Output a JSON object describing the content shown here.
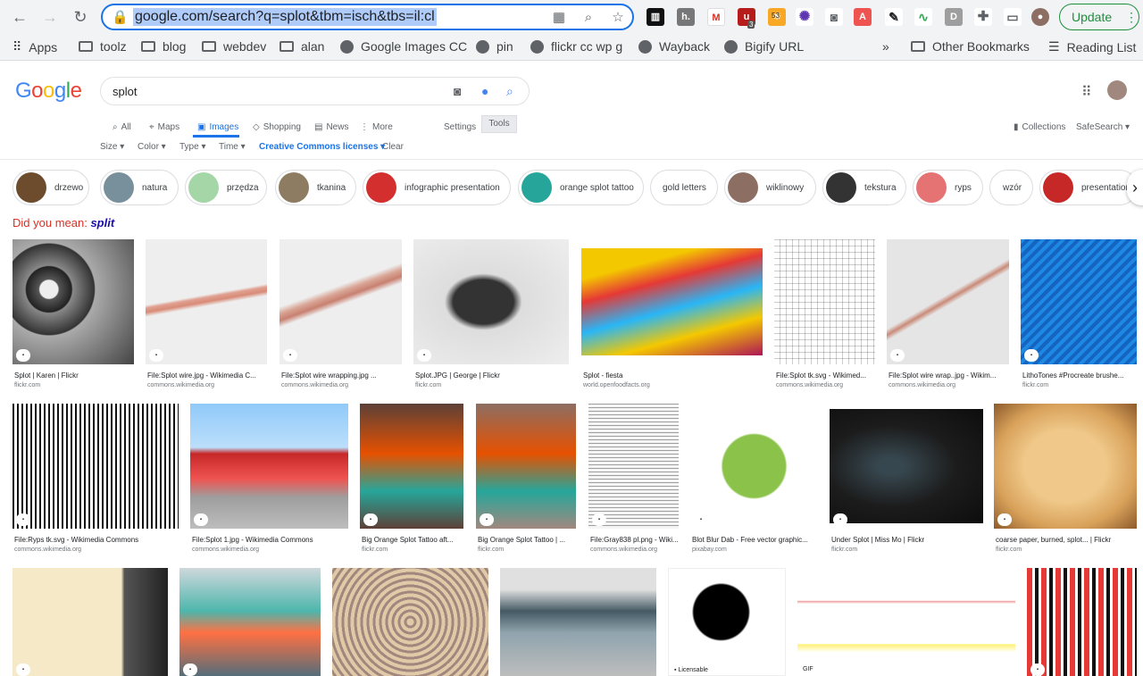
{
  "browser": {
    "url": "google.com/search?q=splot&tbm=isch&tbs=il:cl",
    "update_label": "Update",
    "ext_badge_1": "3",
    "ext_badge_2": "53"
  },
  "bookmarks": [
    {
      "label": "Apps",
      "icon": "apps-grid-icon"
    },
    {
      "label": "toolz",
      "icon": "folder-icon"
    },
    {
      "label": "blog",
      "icon": "folder-icon"
    },
    {
      "label": "webdev",
      "icon": "folder-icon"
    },
    {
      "label": "alan",
      "icon": "folder-icon"
    },
    {
      "label": "Google Images CC",
      "icon": "globe-icon"
    },
    {
      "label": "pin",
      "icon": "globe-icon"
    },
    {
      "label": "flickr cc wp g",
      "icon": "globe-icon"
    },
    {
      "label": "Wayback",
      "icon": "globe-icon"
    },
    {
      "label": "Bigify URL",
      "icon": "globe-icon"
    }
  ],
  "bookmarks_overflow": "»",
  "other_bookmarks": "Other Bookmarks",
  "reading_list": "Reading List",
  "google": {
    "logo": [
      "G",
      "o",
      "o",
      "g",
      "l",
      "e"
    ],
    "logo_colors": [
      "#4285f4",
      "#ea4335",
      "#fbbc05",
      "#4285f4",
      "#34a853",
      "#ea4335"
    ],
    "query": "splot"
  },
  "tabs": {
    "all": "All",
    "maps": "Maps",
    "images": "Images",
    "shopping": "Shopping",
    "news": "News",
    "more": "More",
    "settings": "Settings",
    "tools": "Tools",
    "collections": "Collections",
    "safesearch": "SafeSearch ▾"
  },
  "filters": {
    "size": "Size ▾",
    "color": "Color ▾",
    "type": "Type ▾",
    "time": "Time ▾",
    "license": "Creative Commons licenses ▾",
    "clear": "Clear"
  },
  "chips": [
    "drzewo",
    "natura",
    "przędza",
    "tkanina",
    "infographic presentation",
    "orange splot tattoo",
    "gold letters",
    "wiklinowy",
    "tekstura",
    "ryps",
    "wzór",
    "presentation"
  ],
  "did_you_mean": {
    "label": "Did you mean:",
    "term": "split"
  },
  "results_row1": [
    {
      "caption": "Splot | Karen | Flickr",
      "source": "flickr.com"
    },
    {
      "caption": "File:Splot wire.jpg - Wikimedia C...",
      "source": "commons.wikimedia.org"
    },
    {
      "caption": "File:Splot wire wrapping.jpg ...",
      "source": "commons.wikimedia.org"
    },
    {
      "caption": "Splot.JPG | George | Flickr",
      "source": "flickr.com"
    },
    {
      "caption": "Splot - fiesta",
      "source": "world.openfoodfacts.org"
    },
    {
      "caption": "File:Splot tk.svg - Wikimed...",
      "source": "commons.wikimedia.org"
    },
    {
      "caption": "File:Splot wire wrap..jpg - Wikim...",
      "source": "commons.wikimedia.org"
    },
    {
      "caption": "LithoTones #Procreate brushe...",
      "source": "flickr.com"
    }
  ],
  "results_row2": [
    {
      "caption": "File:Ryps tk.svg - Wikimedia Commons",
      "source": "commons.wikimedia.org"
    },
    {
      "caption": "File:Splot 1.jpg - Wikimedia Commons",
      "source": "commons.wikimedia.org"
    },
    {
      "caption": "Big Orange Splot Tattoo aft...",
      "source": "flickr.com"
    },
    {
      "caption": "Big Orange Splot Tattoo | ...",
      "source": "flickr.com"
    },
    {
      "caption": "File:Gray838 pl.png - Wiki...",
      "source": "commons.wikimedia.org"
    },
    {
      "caption": "Blot Blur Dab - Free vector graphic...",
      "source": "pixabay.com"
    },
    {
      "caption": "Under Splot | Miss Mo | Flickr",
      "source": "flickr.com"
    },
    {
      "caption": "coarse paper, burned, splot... | Flickr",
      "source": "flickr.com"
    }
  ],
  "licensable_label": "Licensable",
  "gif_label": "GIF"
}
